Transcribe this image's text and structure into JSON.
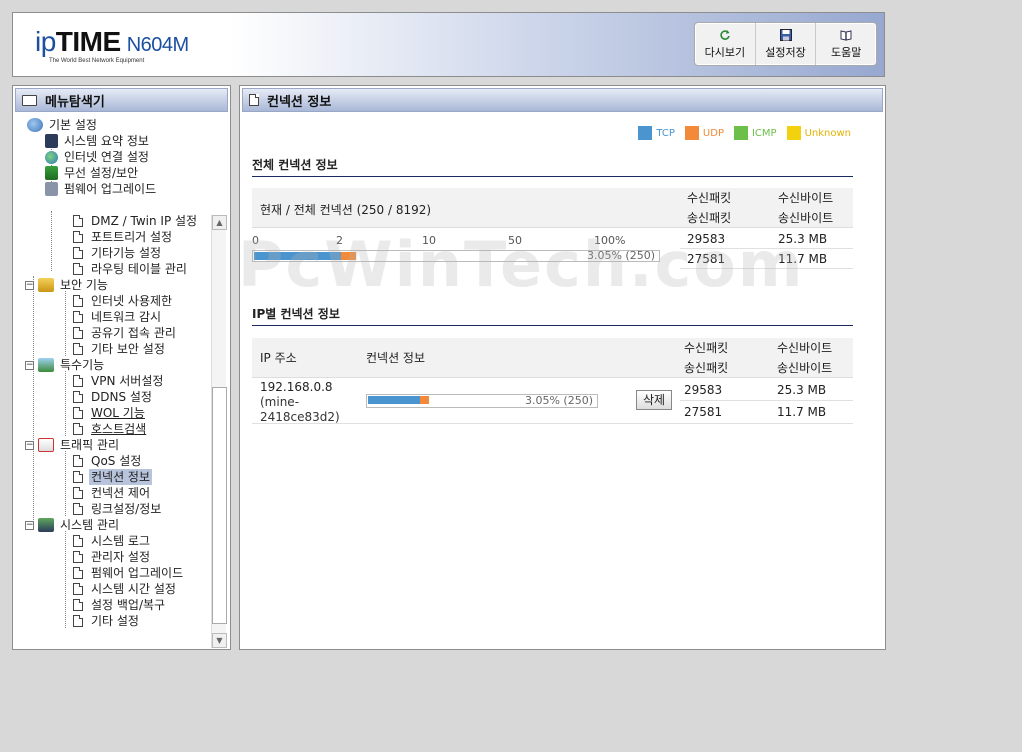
{
  "header": {
    "logo_ip": "ip",
    "logo_time": "TIME",
    "logo_model": "N604M",
    "logo_tagline": "The World Best Network Equipment",
    "toolbar": [
      {
        "label": "다시보기",
        "icon": "refresh-icon"
      },
      {
        "label": "설정저장",
        "icon": "save-icon"
      },
      {
        "label": "도움말",
        "icon": "help-book-icon"
      }
    ]
  },
  "sidebar": {
    "title": "메뉴탐색기",
    "basic": {
      "label": "기본 설정",
      "items": [
        "시스템 요약 정보",
        "인터넷 연결 설정",
        "무선 설정/보안",
        "펌웨어 업그레이드"
      ]
    },
    "advanced_items": [
      "DMZ / Twin IP 설정",
      "포트트리거 설정",
      "기타기능 설정",
      "라우팅 테이블 관리"
    ],
    "security": {
      "label": "보안 기능",
      "items": [
        "인터넷 사용제한",
        "네트워크 감시",
        "공유기 접속 관리",
        "기타 보안 설정"
      ]
    },
    "special": {
      "label": "특수기능",
      "items": [
        "VPN 서버설정",
        "DDNS 설정",
        "WOL 기능",
        "호스트검색"
      ]
    },
    "traffic": {
      "label": "트래픽 관리",
      "items": [
        "QoS 설정",
        "컨넥션 정보",
        "컨넥션 제어",
        "링크설정/정보"
      ]
    },
    "system": {
      "label": "시스템 관리",
      "items": [
        "시스템 로그",
        "관리자 설정",
        "펌웨어 업그레이드",
        "시스템 시간 설정",
        "설정 백업/복구",
        "기타 설정"
      ]
    }
  },
  "main": {
    "title": "컨넥션 정보",
    "legend": [
      {
        "label": "TCP",
        "color": "#4a95cf"
      },
      {
        "label": "UDP",
        "color": "#f28a3a"
      },
      {
        "label": "ICMP",
        "color": "#6cc04a"
      },
      {
        "label": "Unknown",
        "color": "#f2d20e"
      }
    ],
    "total": {
      "section_title": "전체 컨넥션 정보",
      "header_label": "현재 / 전체 컨넥션 (250 / 8192)",
      "col_rx_packets": "수신패킷",
      "col_tx_packets": "송신패킷",
      "col_rx_bytes": "수신바이트",
      "col_tx_bytes": "송신바이트",
      "scale": [
        "0",
        "2",
        "10",
        "50",
        "100%"
      ],
      "bar_label": "3.05% (250)",
      "tcp_fraction": 0.85,
      "udp_fraction": 0.15,
      "rx_packets": "29583",
      "rx_bytes": "25.3 MB",
      "tx_packets": "27581",
      "tx_bytes": "11.7 MB"
    },
    "per_ip": {
      "section_title": "IP별 컨넥션 정보",
      "col_ip": "IP 주소",
      "col_conn": "컨넥션 정보",
      "col_rx_packets": "수신패킷",
      "col_tx_packets": "송신패킷",
      "col_rx_bytes": "수신바이트",
      "col_tx_bytes": "송신바이트",
      "ip": "192.168.0.8",
      "host_line1": "(mine-",
      "host_line2": "2418ce83d2)",
      "bar_label": "3.05% (250)",
      "delete_label": "삭제",
      "rx_packets": "29583",
      "rx_bytes": "25.3 MB",
      "tx_packets": "27581",
      "tx_bytes": "11.7 MB"
    },
    "watermark": "PcWinTech.com"
  }
}
